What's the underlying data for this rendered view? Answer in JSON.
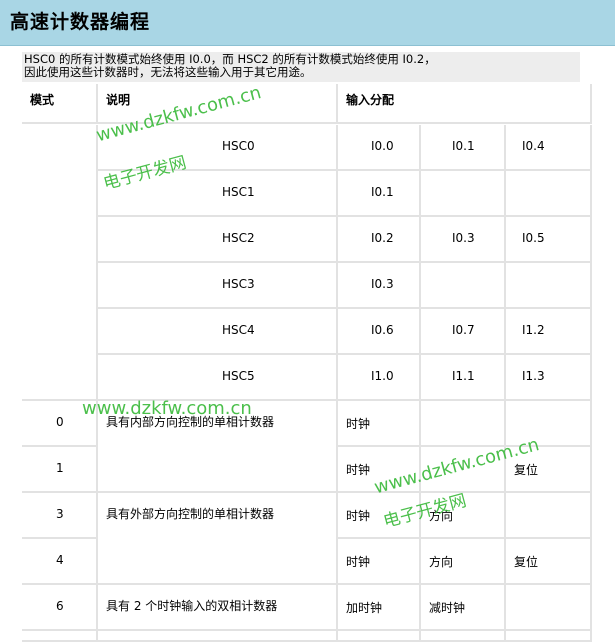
{
  "page_title": "高速计数器编程",
  "note_lines": [
    "HSC0 的所有计数模式始终使用 I0.0，而 HSC2 的所有计数模式始终使用 I0.2，",
    "因此使用这些计数器时，无法将这些输入用于其它用途。"
  ],
  "headers": {
    "mode": "模式",
    "desc": "说明",
    "inputs": "输入分配"
  },
  "counters": [
    {
      "name": "HSC0",
      "inputs": [
        "I0.0",
        "I0.1",
        "I0.4"
      ]
    },
    {
      "name": "HSC1",
      "inputs": [
        "I0.1",
        "",
        ""
      ]
    },
    {
      "name": "HSC2",
      "inputs": [
        "I0.2",
        "I0.3",
        "I0.5"
      ]
    },
    {
      "name": "HSC3",
      "inputs": [
        "I0.3",
        "",
        ""
      ]
    },
    {
      "name": "HSC4",
      "inputs": [
        "I0.6",
        "I0.7",
        "I1.2"
      ]
    },
    {
      "name": "HSC5",
      "inputs": [
        "I1.0",
        "I1.1",
        "I1.3"
      ]
    }
  ],
  "modes": [
    {
      "mode": "0",
      "desc": "具有内部方向控制的单相计数器",
      "inputs": [
        "时钟",
        "",
        ""
      ]
    },
    {
      "mode": "1",
      "desc": "",
      "inputs": [
        "时钟",
        "",
        "复位"
      ]
    },
    {
      "mode": "3",
      "desc": "具有外部方向控制的单相计数器",
      "inputs": [
        "时钟",
        "方向",
        ""
      ]
    },
    {
      "mode": "4",
      "desc": "",
      "inputs": [
        "时钟",
        "方向",
        "复位"
      ]
    },
    {
      "mode": "6",
      "desc": "具有 2 个时钟输入的双相计数器",
      "inputs": [
        "加时钟",
        "减时钟",
        ""
      ]
    }
  ],
  "watermarks": {
    "url": "www.dzkfw.com.cn",
    "cn": "电子开发网"
  }
}
